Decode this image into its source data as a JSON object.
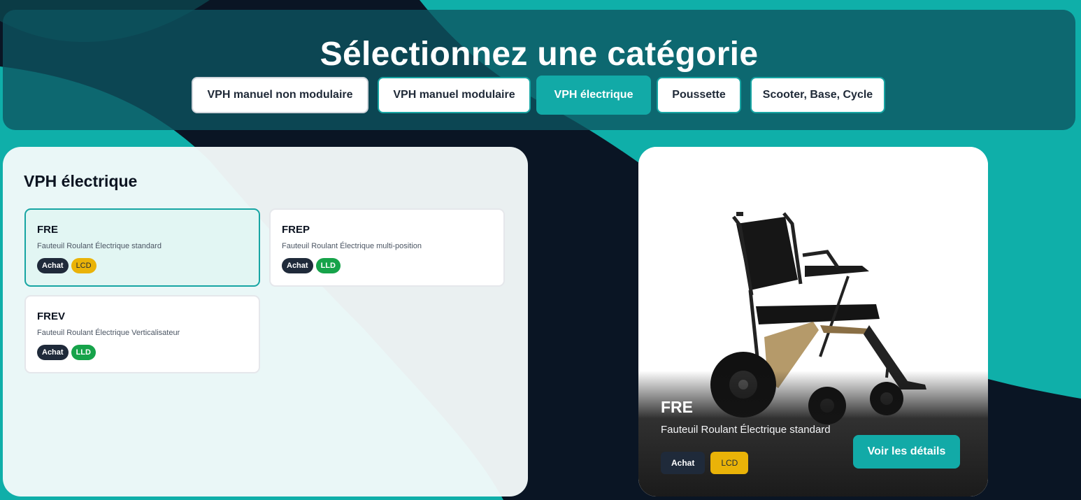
{
  "header": {
    "title": "Sélectionnez une catégorie",
    "tabs": [
      {
        "label": "VPH manuel non modulaire",
        "active": false
      },
      {
        "label": "VPH manuel modulaire",
        "active": false
      },
      {
        "label": "VPH électrique",
        "active": true
      },
      {
        "label": "Poussette",
        "active": false
      },
      {
        "label": "Scooter, Base, Cycle",
        "active": false
      }
    ]
  },
  "category": {
    "title": "VPH électrique",
    "items": [
      {
        "code": "FRE",
        "description": "Fauteuil Roulant Électrique standard",
        "tags": [
          "Achat",
          "LCD"
        ],
        "selected": true
      },
      {
        "code": "FREP",
        "description": "Fauteuil Roulant Électrique multi-position",
        "tags": [
          "Achat",
          "LLD"
        ],
        "selected": false
      },
      {
        "code": "FREV",
        "description": "Fauteuil Roulant Électrique Verticalisateur",
        "tags": [
          "Achat",
          "LLD"
        ],
        "selected": false
      }
    ]
  },
  "preview": {
    "code": "FRE",
    "description": "Fauteuil Roulant Électrique standard",
    "tags": [
      "Achat",
      "LCD"
    ],
    "details_button": "Voir les détails",
    "image_icon": "wheelchair-image"
  },
  "colors": {
    "accent": "#12aaa7",
    "background_dark": "#0a1524",
    "tag_dark": "#1f2a3a",
    "tag_lcd": "#eab308",
    "tag_lld": "#16a34a"
  }
}
